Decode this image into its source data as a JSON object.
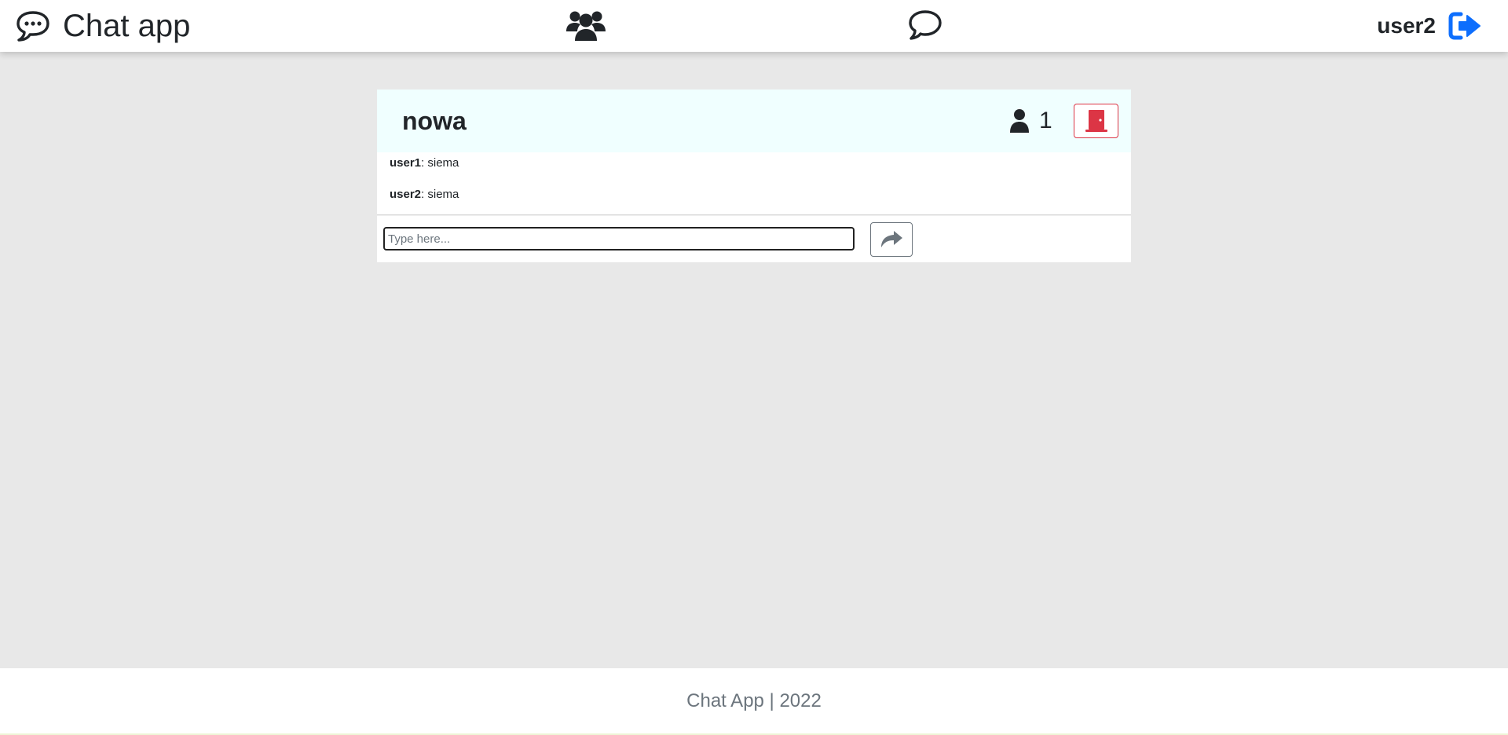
{
  "app": {
    "brand_title": "Chat app",
    "brand_icon": "chat-bubble-dots-icon"
  },
  "nav": {
    "users_icon": "users-icon",
    "chats_icon": "chat-bubble-icon",
    "username": "user2",
    "logout_icon": "logout-icon"
  },
  "room": {
    "name": "nowa",
    "member_icon": "user-icon",
    "member_count": "1",
    "leave_icon": "door-icon"
  },
  "messages": [
    {
      "author": "user1",
      "separator": ": ",
      "text": "siema"
    },
    {
      "author": "user2",
      "separator": ": ",
      "text": "siema"
    }
  ],
  "composer": {
    "placeholder": "Type here...",
    "value": "",
    "send_icon": "share-arrow-icon"
  },
  "footer": {
    "text": "Chat App | 2022"
  },
  "colors": {
    "page_background": "#e8e8e8",
    "header_background": "#f0ffff",
    "danger": "#dc3545",
    "primary": "#0d6efd",
    "secondary": "#6c757d",
    "text": "#212529"
  }
}
